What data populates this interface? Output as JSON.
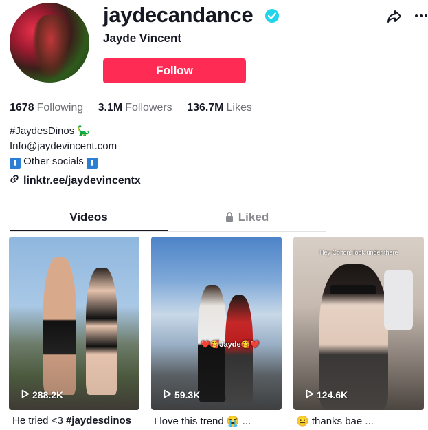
{
  "profile": {
    "username": "jaydecandance",
    "nickname": "Jayde Vincent",
    "follow_label": "Follow",
    "verified": true
  },
  "stats": [
    {
      "value": "1678",
      "label": "Following"
    },
    {
      "value": "3.1M",
      "label": "Followers"
    },
    {
      "value": "136.7M",
      "label": "Likes"
    }
  ],
  "bio": {
    "line1": "#JaydesDinos",
    "line1_emoji": "🦕",
    "line2": "Info@jaydevincent.com",
    "line3_arrow": "⬇",
    "line3": "Other socials",
    "link": "linktr.ee/jaydevincentx"
  },
  "tabs": [
    {
      "label": "Videos",
      "active": true
    },
    {
      "label": "Liked",
      "active": false,
      "locked": true
    }
  ],
  "videos": [
    {
      "views": "288.2K",
      "caption_text": "He tried <3 ",
      "caption_tag": "#jaydesdinos"
    },
    {
      "views": "59.3K",
      "caption_text": "I love this trend 😭 ...",
      "overlay": "❤️🥰Jayde🥰❤️"
    },
    {
      "views": "124.6K",
      "caption_text": "😐 thanks bae ...",
      "overlay": "Hey Colton, look under there"
    }
  ],
  "colors": {
    "accent": "#fe2c55",
    "verified": "#20d5ec",
    "text": "#161823",
    "muted": "#6d6e75"
  }
}
